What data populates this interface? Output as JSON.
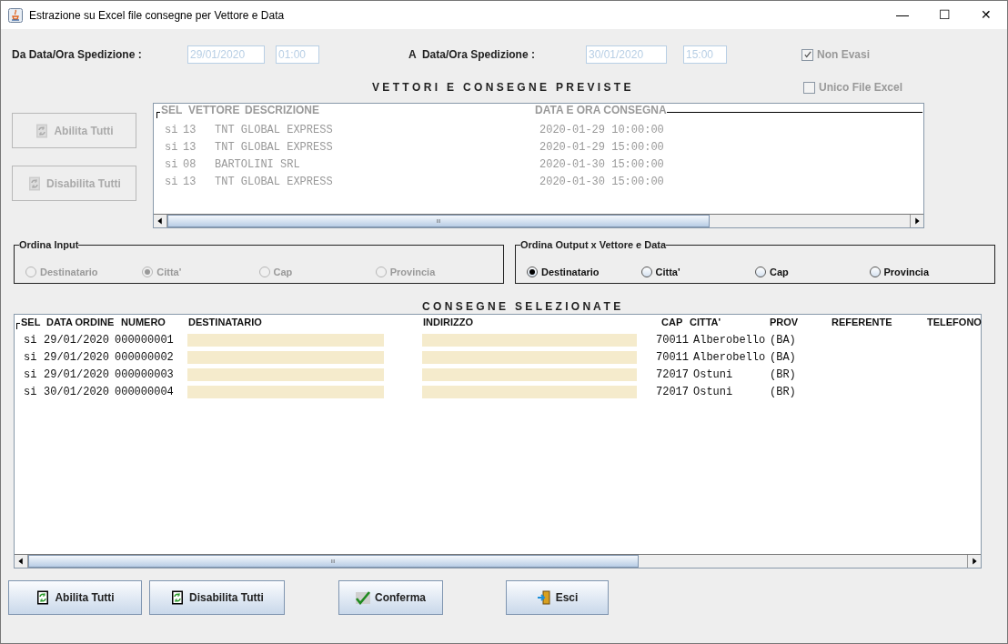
{
  "window": {
    "title": "Estrazione su Excel file consegne per Vettore e Data",
    "controls": [
      "—",
      "☐",
      "✕"
    ]
  },
  "filters": {
    "from_label": "Da Data/Ora Spedizione :",
    "from_date": "29/01/2020",
    "from_time": "01:00",
    "to_label": "A  Data/Ora Spedizione :",
    "to_date": "30/01/2020",
    "to_time": "15:00",
    "fields_disabled": true
  },
  "checkboxes": [
    {
      "label": "Non Evasi",
      "checked": true,
      "disabled": true
    },
    {
      "label": "Unico File Excel",
      "checked": false,
      "disabled": true
    }
  ],
  "carriers": {
    "title": "V E T T O R I   E   C O N S E G N E   P R E V I S T E",
    "columns": [
      "SEL",
      "VETTORE",
      "DESCRIZIONE",
      "DATA E ORA CONSEGNA"
    ],
    "disabled": true,
    "rows": [
      [
        "si",
        "13",
        "TNT GLOBAL EXPRESS",
        "2020-01-29 10:00:00"
      ],
      [
        "si",
        "13",
        "TNT GLOBAL EXPRESS",
        "2020-01-29 15:00:00"
      ],
      [
        "si",
        "08",
        "BARTOLINI SRL",
        "2020-01-30 15:00:00"
      ],
      [
        "si",
        "13",
        "TNT GLOBAL EXPRESS",
        "2020-01-30 15:00:00"
      ]
    ]
  },
  "side_buttons": [
    {
      "label": "Abilita Tutti",
      "kind": "refresh",
      "disabled": true
    },
    {
      "label": "Disabilita Tutti",
      "kind": "refresh",
      "disabled": true
    }
  ],
  "sort_groups": [
    {
      "title": "Ordina Input",
      "options": [
        {
          "label": "Destinatario",
          "selected": false,
          "disabled": true
        },
        {
          "label": "Citta'",
          "selected": true,
          "disabled": true
        },
        {
          "label": "Cap",
          "selected": false,
          "disabled": true
        },
        {
          "label": "Provincia",
          "selected": false,
          "disabled": true
        }
      ]
    },
    {
      "title": "Ordina Output x Vettore e Data",
      "options": [
        {
          "label": "Destinatario",
          "selected": true,
          "disabled": false
        },
        {
          "label": "Citta'",
          "selected": false,
          "disabled": false
        },
        {
          "label": "Cap",
          "selected": false,
          "disabled": false
        },
        {
          "label": "Provincia",
          "selected": false,
          "disabled": false
        }
      ]
    }
  ],
  "deliveries": {
    "title": "C O N S E G N E   S E L E Z I O N A T E",
    "columns": [
      "SEL",
      "DATA ORDINE",
      "NUMERO",
      "DESTINATARIO",
      "INDIRIZZO",
      "CAP",
      "CITTA'",
      "PROV",
      "REFERENTE",
      "TELEFONO"
    ],
    "rows": [
      [
        "si",
        "29/01/2020",
        "000000001",
        "",
        "",
        "70011",
        "Alberobello",
        "(BA)"
      ],
      [
        "si",
        "29/01/2020",
        "000000002",
        "",
        "",
        "70011",
        "Alberobello",
        "(BA)"
      ],
      [
        "si",
        "29/01/2020",
        "000000003",
        "",
        "",
        "72017",
        "Ostuni",
        "(BR)"
      ],
      [
        "si",
        "30/01/2020",
        "000000004",
        "",
        "",
        "72017",
        "Ostuni",
        "(BR)"
      ]
    ]
  },
  "bottom_buttons": [
    {
      "label": "Abilita Tutti",
      "kind": "refresh"
    },
    {
      "label": "Disabilita Tutti",
      "kind": "refresh"
    },
    {
      "label": "Conferma",
      "kind": "check"
    },
    {
      "label": "Esci",
      "kind": "exit"
    }
  ]
}
